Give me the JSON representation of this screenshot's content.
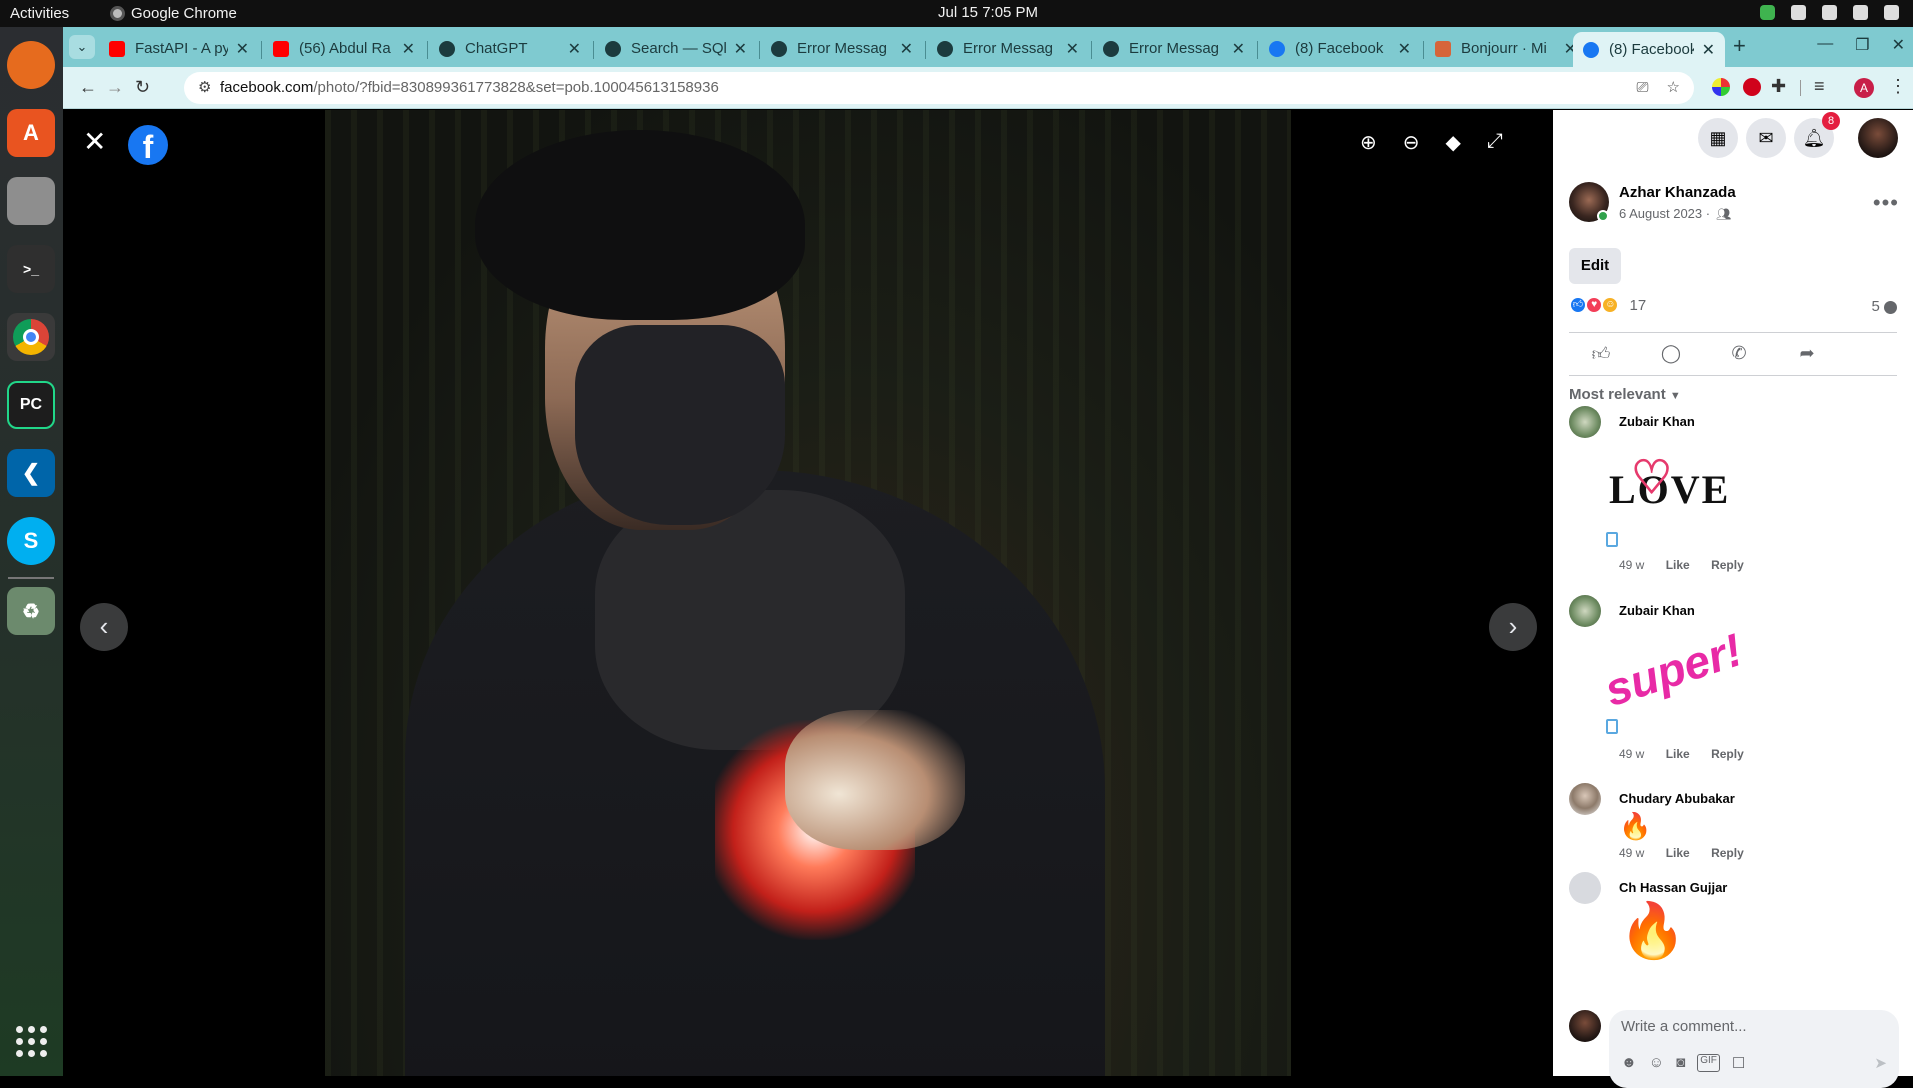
{
  "os": {
    "activities": "Activities",
    "app_name": "Google Chrome",
    "clock": "Jul 15  7:05 PM"
  },
  "browser": {
    "tabs": [
      {
        "title": "FastAPI - A py",
        "icon": "youtube-icon"
      },
      {
        "title": "(56) Abdul Ra",
        "icon": "youtube-icon"
      },
      {
        "title": "ChatGPT",
        "icon": "chatgpt-icon"
      },
      {
        "title": "Search — SQl",
        "icon": "openai-icon"
      },
      {
        "title": "Error Messag",
        "icon": "openai-icon"
      },
      {
        "title": "Error Messag",
        "icon": "openai-icon"
      },
      {
        "title": "Error Messag",
        "icon": "openai-icon"
      },
      {
        "title": "(8) Facebook",
        "icon": "facebook-icon"
      },
      {
        "title": "Bonjourr · Mi",
        "icon": "bonjourr-icon"
      },
      {
        "title": "(8) Facebook",
        "icon": "facebook-icon",
        "active": true
      }
    ],
    "url_host": "facebook.com",
    "url_path": "/photo/?fbid=830899361773828&set=pob.100045613158936",
    "profile_initial": "A"
  },
  "facebook": {
    "notifications_count": "8",
    "post": {
      "author": "Azhar Khanzada",
      "date": "6 August 2023 ·",
      "edit_label": "Edit",
      "reaction_count": "17",
      "comment_count": "5",
      "sort_label": "Most relevant"
    },
    "comments": [
      {
        "name": "Zubair Khan",
        "sticker": "LOVE",
        "time": "49 w",
        "like": "Like",
        "reply": "Reply"
      },
      {
        "name": "Zubair Khan",
        "sticker": "super!",
        "time": "49 w",
        "like": "Like",
        "reply": "Reply"
      },
      {
        "name": "Chudary Abubakar",
        "sticker": "🔥",
        "time": "49 w",
        "like": "Like",
        "reply": "Reply"
      },
      {
        "name": "Ch Hassan Gujjar",
        "sticker": "🔥"
      }
    ],
    "composer_placeholder": "Write a comment..."
  },
  "colors": {
    "tabstrip": "#7fcad0",
    "toolbar": "#dff3f5",
    "facebook_blue": "#1877f2",
    "badge_red": "#e41e3f"
  }
}
